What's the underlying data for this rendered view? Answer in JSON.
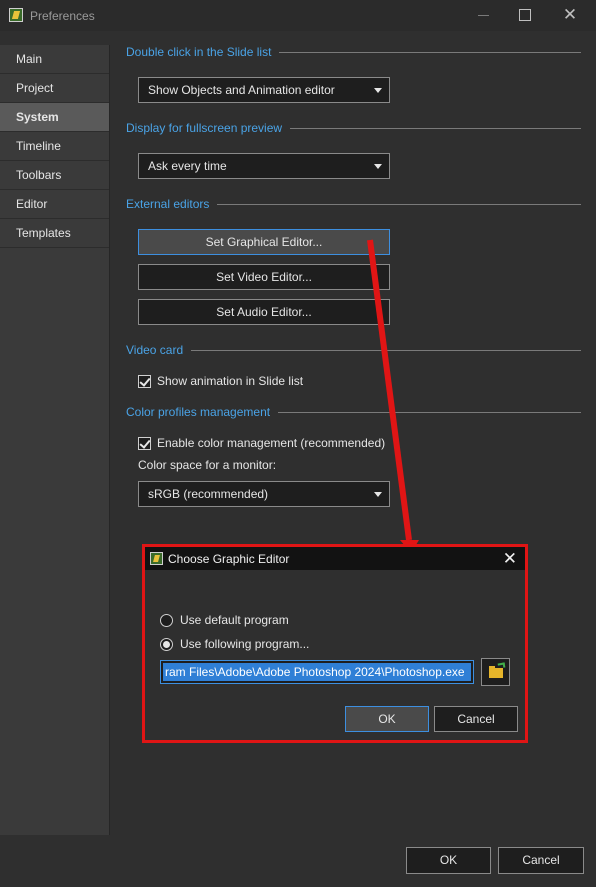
{
  "window": {
    "title": "Preferences"
  },
  "sidebar": {
    "items": [
      {
        "label": "Main"
      },
      {
        "label": "Project"
      },
      {
        "label": "System"
      },
      {
        "label": "Timeline"
      },
      {
        "label": "Toolbars"
      },
      {
        "label": "Editor"
      },
      {
        "label": "Templates"
      }
    ],
    "active": "System"
  },
  "sections": {
    "double_click": {
      "header": "Double click in the Slide list",
      "dropdown_value": "Show Objects and Animation editor"
    },
    "fullscreen": {
      "header": "Display for fullscreen preview",
      "dropdown_value": "Ask every time"
    },
    "external_editors": {
      "header": "External editors",
      "graphical_button": "Set Graphical Editor...",
      "video_button": "Set Video Editor...",
      "audio_button": "Set Audio Editor..."
    },
    "video_card": {
      "header": "Video card",
      "show_animation_label": "Show animation in Slide list",
      "show_animation_checked": true
    },
    "color_profiles": {
      "header": "Color profiles management",
      "enable_label": "Enable color management (recommended)",
      "enable_checked": true,
      "color_space_label": "Color space for a monitor:",
      "dropdown_value": "sRGB (recommended)"
    }
  },
  "dialog": {
    "title": "Choose Graphic Editor",
    "radio_default": "Use default program",
    "radio_following": "Use following program...",
    "selected_radio": "following",
    "path_value": "ram Files\\Adobe\\Adobe Photoshop 2024\\Photoshop.exe",
    "ok_label": "OK",
    "cancel_label": "Cancel",
    "border_color": "#e01515"
  },
  "footer": {
    "ok_label": "OK",
    "cancel_label": "Cancel"
  },
  "colors": {
    "accent": "#4aa3e6",
    "annotation": "#e01515",
    "selection": "#2f7fd6"
  }
}
